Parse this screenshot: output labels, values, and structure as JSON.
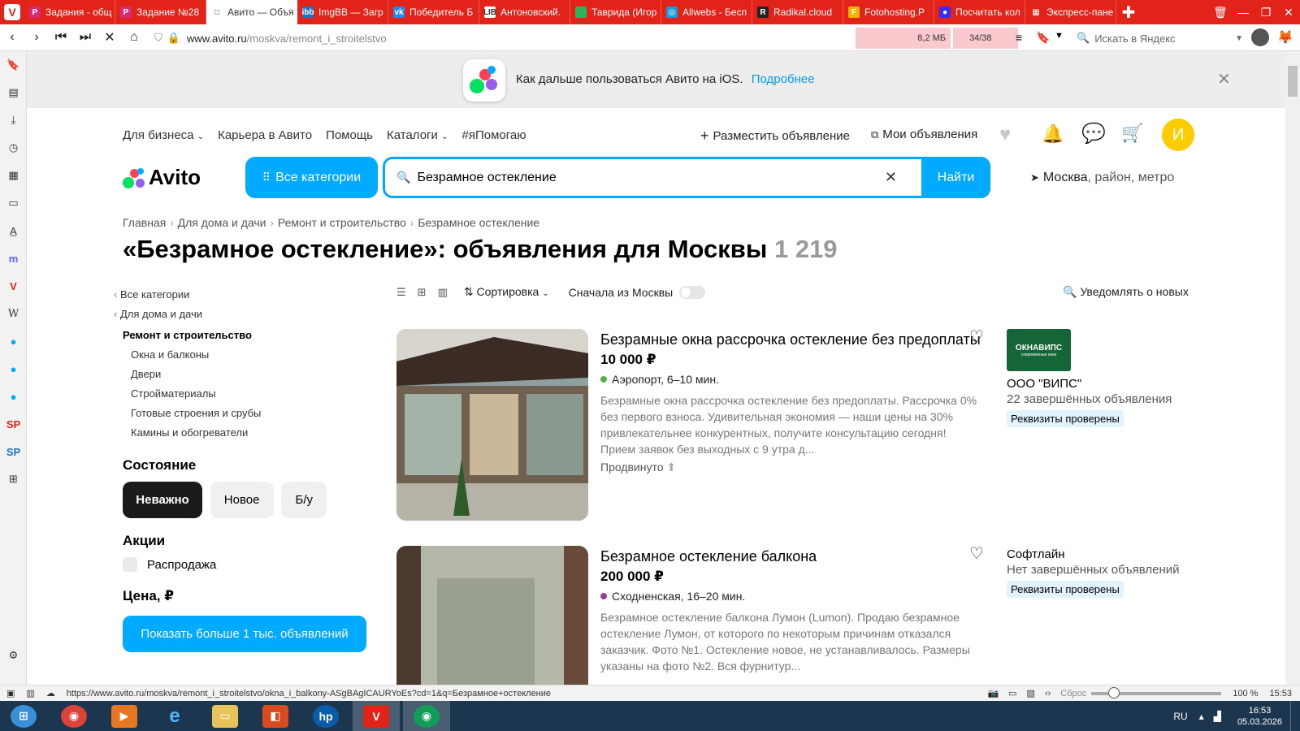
{
  "browser": {
    "tabs": [
      {
        "label": "Задания - общ",
        "fav": "P",
        "favcolor": "#d82b73"
      },
      {
        "label": "Задание №28",
        "fav": "P",
        "favcolor": "#d82b73"
      },
      {
        "label": "Авито — Объя",
        "fav": "□",
        "favcolor": "#ffffff",
        "active": true
      },
      {
        "label": "ImgBB — Загр",
        "fav": "ibb",
        "favcolor": "#1d72c2"
      },
      {
        "label": "Победитель Б",
        "fav": "vk",
        "favcolor": "#2787f5"
      },
      {
        "label": "Антоновский.",
        "fav": "LIB",
        "favcolor": "#ffffff"
      },
      {
        "label": "Таврида (Игор",
        "fav": "",
        "favcolor": "#2fb35a"
      },
      {
        "label": "Allwebs - Бесп",
        "fav": "◎",
        "favcolor": "#1d9bd8"
      },
      {
        "label": "Radikal.cloud",
        "fav": "R",
        "favcolor": "#222222"
      },
      {
        "label": "Fotohosting.P",
        "fav": "F",
        "favcolor": "#f0b400"
      },
      {
        "label": "Посчитать кол",
        "fav": "●",
        "favcolor": "#3b2cf5"
      },
      {
        "label": "Экспресс-пане",
        "fav": "▦",
        "favcolor": "#e2231a"
      }
    ],
    "url_prefix": "www.avito.ru",
    "url_path": "/moskva/remont_i_stroitelstvo",
    "memory": "8,2 МБ",
    "page_counter": "34/38",
    "search_placeholder": "Искать в Яндекс",
    "status_url": "https://www.avito.ru/moskva/remont_i_stroitelstvo/okna_i_balkony-ASgBAgICAURYoEs?cd=1&q=Безрамное+остекление",
    "reset_label": "Сброс",
    "zoom": "100 %",
    "zoom_level": 0.13,
    "time": "15:53"
  },
  "banner": {
    "text": "Как дальше пользоваться Авито на iOS.",
    "link": "Подробнее"
  },
  "topnav": {
    "left": [
      "Для бизнеса",
      "Карьера в Авито",
      "Помощь",
      "Каталоги",
      "#яПомогаю"
    ],
    "post_ad": "Разместить объявление",
    "my_ads": "Мои объявления",
    "avatar_letter": "И"
  },
  "logo": "Avito",
  "categories_button": "Все категории",
  "search": {
    "value": "Безрамное остекление",
    "button": "Найти"
  },
  "location": {
    "city": "Москва",
    "rest": ", район, метро"
  },
  "breadcrumb": [
    "Главная",
    "Для дома и дачи",
    "Ремонт и строительство",
    "Безрамное остекление"
  ],
  "heading": {
    "title": "«Безрамное остекление»: объявления для Москвы",
    "count": "1 219"
  },
  "toolbar": {
    "sort": "Сортировка",
    "moscow_first": "Сначала из Москвы",
    "notify": "Уведомлять о новых"
  },
  "filters": {
    "back_all": "Все категории",
    "back_home": "Для дома и дачи",
    "current": "Ремонт и строительство",
    "subcats": [
      "Окна и балконы",
      "Двери",
      "Стройматериалы",
      "Готовые строения и срубы",
      "Камины и обогреватели"
    ],
    "condition_title": "Состояние",
    "conditions": [
      "Неважно",
      "Новое",
      "Б/у"
    ],
    "promo_title": "Акции",
    "sale": "Распродажа",
    "price_title": "Цена, ₽",
    "show_more": "Показать больше 1 тыс. объявлений"
  },
  "listings": [
    {
      "title": "Безрамные окна рассрочка остекление без предоплаты",
      "price": "10 000 ₽",
      "metro": "Аэропорт, 6–10 мин.",
      "metro_color": "#4fb04c",
      "description": "Безрамные окна рассрочка остекление без предоплаты. Рассрочка 0% без первого взноса. Удивительная экономия — наши цены на 30% привлекательнее конкурентных, получите консультацию сегодня! Прием заявок без выходных с 9 утра д...",
      "promoted": "Продвинуто",
      "seller": "ООО \"ВИПС\"",
      "seller_stats": "22 завершённых объявления",
      "seller_badge": "Реквизиты проверены",
      "seller_logo": "ОКНАВИПС",
      "seller_logo_sub": "современные окна"
    },
    {
      "title": "Безрамное остекление балкона",
      "price": "200 000 ₽",
      "metro": "Сходненская, 16–20 мин.",
      "metro_color": "#943e90",
      "description": "Безрамное остекление балкона Лумон (Lumon). Продаю безрамное остекление Лумон, от которого по некоторым причинам отказался заказчик. Фото №1. Остекление новое, не устанавливалось. Размеры указаны на фото №2. Вся фурнитур...",
      "seller": "Софтлайн",
      "seller_stats": "Нет завершённых объявлений",
      "seller_badge": "Реквизиты проверены"
    }
  ],
  "taskbar": {
    "lang": "RU",
    "time": "16:53",
    "date": "05.03.2026"
  },
  "colors": {
    "accent": "#00aaff",
    "browser": "#e2231a",
    "avatar": "#ffcc00"
  }
}
